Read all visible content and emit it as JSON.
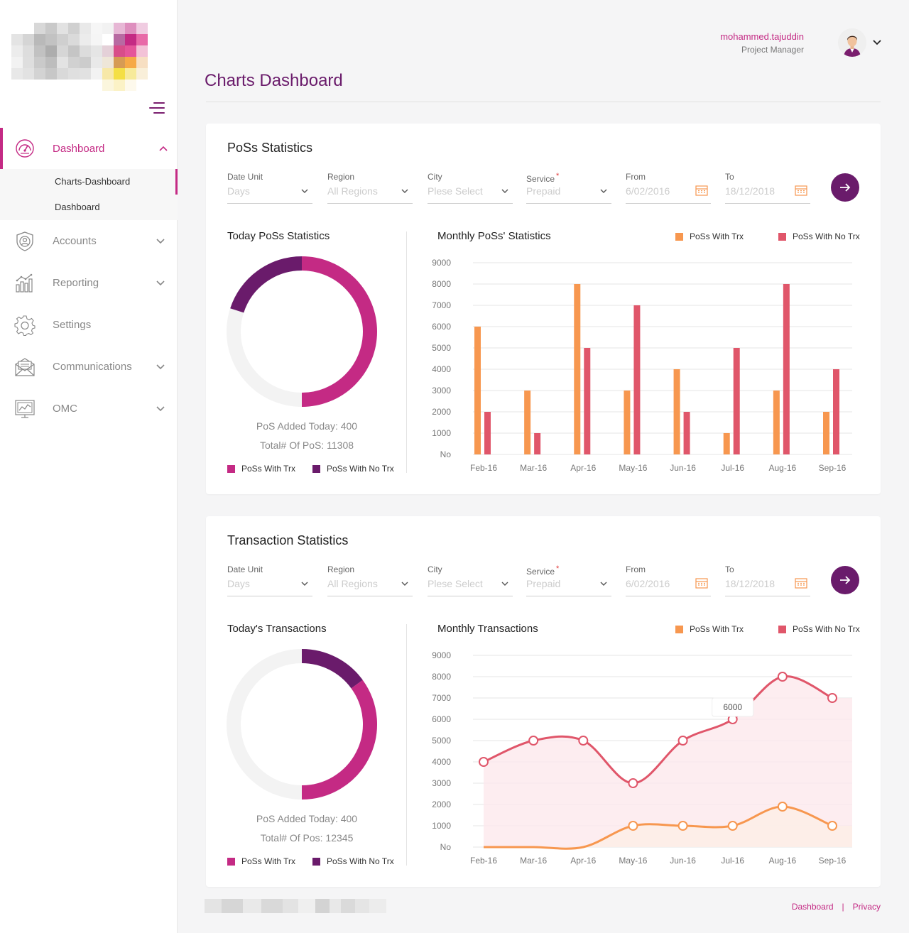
{
  "header": {
    "user_name": "mohammed.tajuddin",
    "user_role": "Project Manager",
    "page_title": "Charts Dashboard"
  },
  "sidebar": {
    "items": [
      {
        "label": "Dashboard",
        "icon": "speedometer-icon",
        "active": true
      },
      {
        "label": "Accounts",
        "icon": "shield-user-icon"
      },
      {
        "label": "Reporting",
        "icon": "bar-chart-icon"
      },
      {
        "label": "Settings",
        "icon": "gear-icon"
      },
      {
        "label": "Communications",
        "icon": "envelope-icon"
      },
      {
        "label": "OMC",
        "icon": "monitor-chart-icon"
      }
    ],
    "subitems": [
      {
        "label": "Charts-Dashboard",
        "current": true
      },
      {
        "label": "Dashboard"
      }
    ]
  },
  "filters": {
    "date_unit": {
      "label": "Date Unit",
      "value": "Days"
    },
    "region": {
      "label": "Region",
      "value": "All Regions"
    },
    "city": {
      "label": "City",
      "value": "Plese Select"
    },
    "service": {
      "label": "Service",
      "value": "Prepaid",
      "required_mark": "*"
    },
    "from": {
      "label": "From",
      "value": "6/02/2016"
    },
    "to": {
      "label": "To",
      "value": "18/12/2018"
    }
  },
  "poss": {
    "title": "PoSs Statistics",
    "today_title": "Today PoSs Statistics",
    "pos_added_today": "PoS Added Today: 400",
    "total_pos": "Total# Of PoS: 11308",
    "donut_share_with_trx": 0.5,
    "donut_share_no_trx": 0.2,
    "monthly_title": "Monthly PoSs' Statistics"
  },
  "trx": {
    "title": "Transaction Statistics",
    "today_title": "Today's Transactions",
    "pos_added_today": "PoS Added Today: 400",
    "total_pos": "Total# Of Pos: 12345",
    "donut_share_with_trx": 0.5,
    "donut_share_no_trx": 0.15,
    "monthly_title": "Monthly Transactions",
    "tooltip_value": "6000"
  },
  "legend": {
    "with_trx": "PoSs With Trx",
    "no_trx": "PoSs With No Trx"
  },
  "colors": {
    "brand_purple": "#6a1b6b",
    "magenta": "#c42a84",
    "orange": "#f7974f",
    "red": "#e0566a"
  },
  "chart_data": [
    {
      "type": "bar",
      "categories": [
        "Feb-16",
        "Mar-16",
        "Apr-16",
        "May-16",
        "Jun-16",
        "Jul-16",
        "Aug-16",
        "Sep-16"
      ],
      "series": [
        {
          "name": "PoSs With Trx",
          "values": [
            6000,
            3000,
            8000,
            3000,
            4000,
            1000,
            3000,
            2000
          ]
        },
        {
          "name": "PoSs With No Trx",
          "values": [
            2000,
            1000,
            5000,
            7000,
            2000,
            5000,
            8000,
            4000
          ]
        }
      ],
      "yticks": [
        "No",
        "1000",
        "2000",
        "3000",
        "4000",
        "5000",
        "6000",
        "7000",
        "8000",
        "9000"
      ],
      "ylim": [
        0,
        9000
      ],
      "grid": true,
      "legend_position": "top-right"
    },
    {
      "type": "area",
      "categories": [
        "Feb-16",
        "Mar-16",
        "Apr-16",
        "May-16",
        "Jun-16",
        "Jul-16",
        "Aug-16",
        "Sep-16"
      ],
      "series": [
        {
          "name": "PoSs With Trx",
          "values": [
            0,
            0,
            0,
            1000,
            1000,
            1000,
            1900,
            1000
          ]
        },
        {
          "name": "PoSs With No Trx",
          "values": [
            4000,
            5000,
            5000,
            3000,
            5000,
            6000,
            8000,
            7000
          ]
        }
      ],
      "yticks": [
        "No",
        "1000",
        "2000",
        "3000",
        "4000",
        "5000",
        "6000",
        "7000",
        "8000",
        "9000"
      ],
      "ylim": [
        0,
        9000
      ],
      "grid": true,
      "legend_position": "top-right"
    }
  ]
}
